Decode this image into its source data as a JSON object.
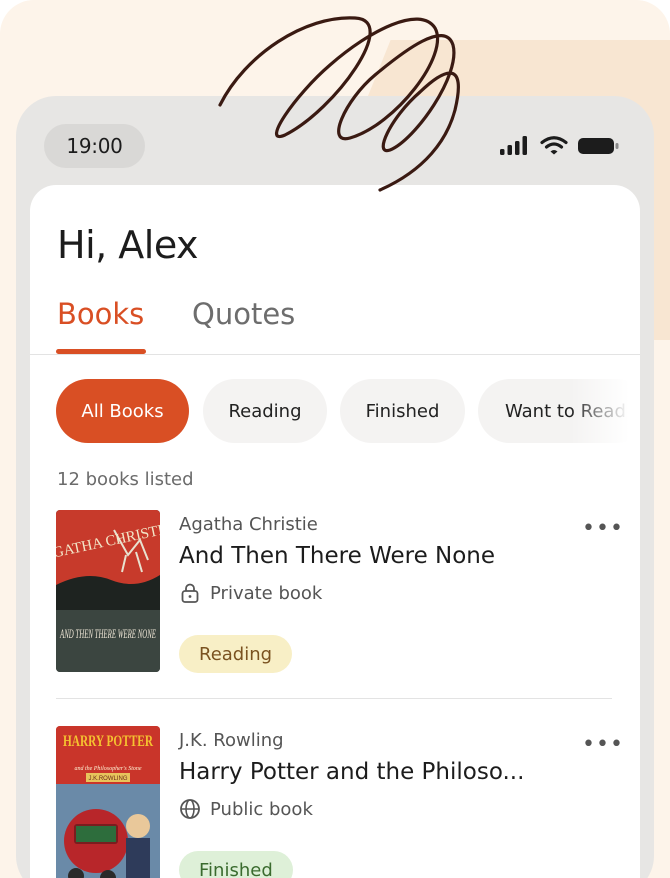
{
  "status_bar": {
    "time": "19:00"
  },
  "greeting": "Hi, Alex",
  "tabs": [
    {
      "label": "Books",
      "active": true
    },
    {
      "label": "Quotes",
      "active": false
    }
  ],
  "filters": [
    {
      "label": "All Books",
      "active": true
    },
    {
      "label": "Reading",
      "active": false
    },
    {
      "label": "Finished",
      "active": false
    },
    {
      "label": "Want to Read",
      "active": false
    }
  ],
  "book_count": "12 books listed",
  "books": [
    {
      "author": "Agatha Christie",
      "title": "And Then There Were None",
      "visibility": "Private book",
      "visibility_icon": "lock-icon",
      "status": "Reading",
      "cover_text_top": "AGATHA CHRISTIE",
      "cover_text_bottom": "AND THEN THERE WERE NONE"
    },
    {
      "author": "J.K. Rowling",
      "title": "Harry Potter and the Philoso...",
      "visibility": "Public book",
      "visibility_icon": "globe-icon",
      "status": "Finished",
      "cover_text_top": "HARRY POTTER",
      "cover_text_sub": "and the Philosopher's Stone",
      "cover_text_author": "J.K.ROWLING"
    }
  ],
  "colors": {
    "accent": "#d94f24",
    "reading_badge": "#f8efc6",
    "finished_badge": "#def0d8",
    "background_cream": "#fdf4ea"
  }
}
